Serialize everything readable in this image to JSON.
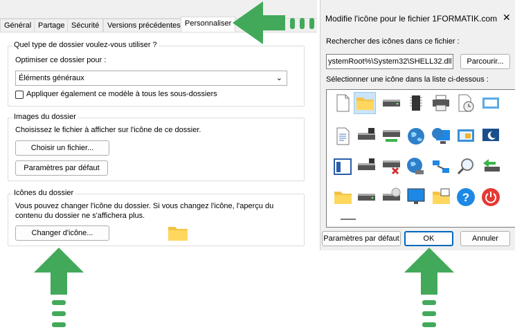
{
  "props": {
    "tabs": [
      "Général",
      "Partage",
      "Sécurité",
      "Versions précédentes",
      "Personnaliser"
    ],
    "active_tab": "Personnaliser",
    "folder_type": {
      "title": "Quel type de dossier voulez-vous utiliser ?",
      "optimize_label": "Optimiser ce dossier pour :",
      "selected": "Éléments généraux",
      "apply_label": "Appliquer également ce modèle à tous les sous-dossiers"
    },
    "images": {
      "title": "Images du dossier",
      "desc": "Choisissez le fichier à afficher sur l'icône de ce dossier.",
      "choose_button": "Choisir un fichier...",
      "default_button": "Paramètres par défaut"
    },
    "icons": {
      "title": "Icônes du dossier",
      "desc_line1": "Vous pouvez changer l'icône du dossier. Si vous changez l'icône, l'aperçu du",
      "desc_line2": "contenu du dossier ne s'affichera plus.",
      "change_button": "Changer d'icône..."
    }
  },
  "dialog": {
    "title": "Modifie l'icône pour le fichier 1FORMATIK.com",
    "close_glyph": "✕",
    "search_label": "Rechercher des icônes dans ce fichier :",
    "path_value": "ystemRoot%\\System32\\SHELL32.dll",
    "browse_button": "Parcourir...",
    "list_label": "Sélectionner une icône dans la liste ci-dessous :",
    "default_button": "Paramètres par défaut",
    "ok_button": "OK",
    "cancel_button": "Annuler"
  },
  "icon_grid": [
    [
      "blank-document-icon",
      "folder-icon",
      "drive-icon",
      "chip-icon",
      "printer-icon",
      "clock-document-icon",
      "window-icon"
    ],
    [
      "text-document-icon",
      "floppy-drive-icon",
      "network-drive-icon",
      "globe-icon",
      "network-globe-icon",
      "settings-screen-icon",
      "sleep-icon"
    ],
    [
      "app-window-icon",
      "disk-drive-icon",
      "disconnected-drive-icon",
      "internet-icon",
      "network-icon",
      "search-icon",
      "arrow-drive-icon"
    ],
    [
      "folder-icon",
      "drive-icon",
      "cd-drive-icon",
      "monitor-icon",
      "grid-folder-icon",
      "help-icon",
      "power-icon"
    ]
  ],
  "colors": {
    "arrow": "#43a95a",
    "accent": "#0067c0"
  }
}
